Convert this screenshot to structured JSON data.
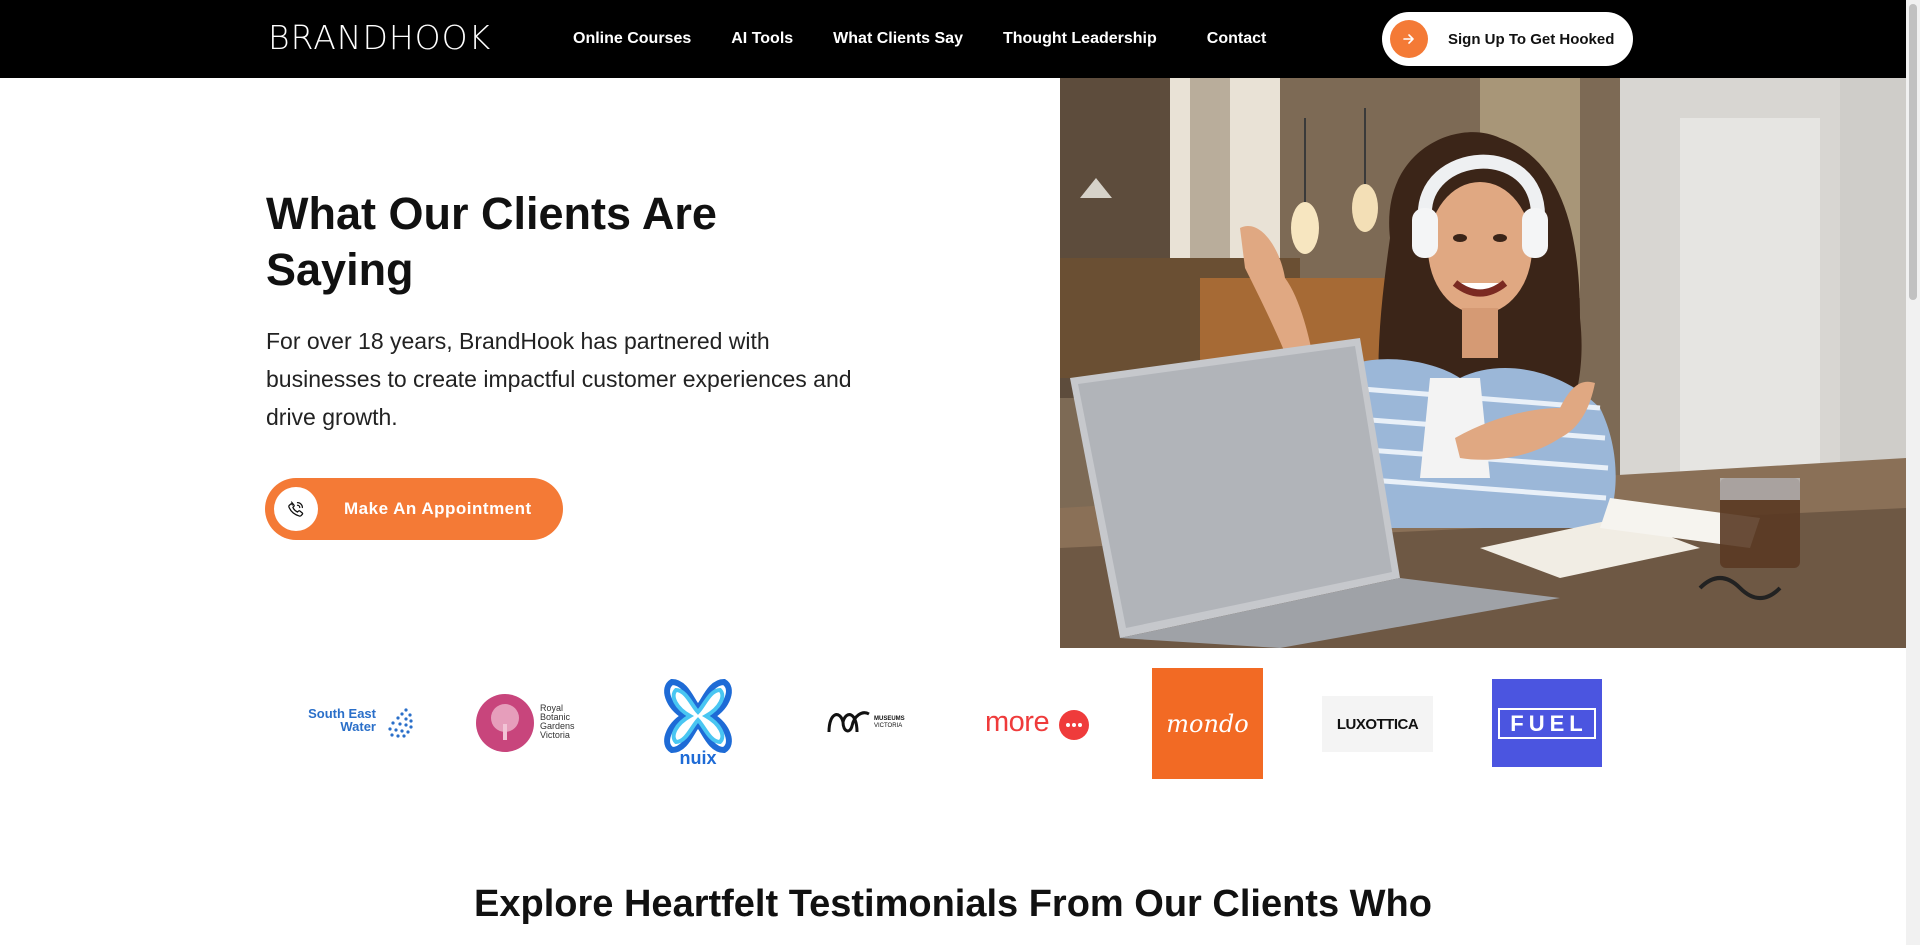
{
  "header": {
    "logo": "BRANDHOOK",
    "nav": [
      "Online Courses",
      "AI Tools",
      "What Clients Say",
      "Thought Leadership",
      "Contact"
    ],
    "cta_label": "Sign Up To Get Hooked",
    "cta_icon": "arrow-right-icon"
  },
  "hero": {
    "title": "What Our Clients Are Saying",
    "subtitle": "For over 18 years, BrandHook has partnered with businesses to create impactful customer experiences and drive growth.",
    "button_label": "Make An Appointment",
    "button_icon": "phone-icon",
    "image": "woman-with-headphones-on-video-call-photo"
  },
  "client_logos": {
    "south_east_water": [
      "South East",
      "Water"
    ],
    "royal_botanic": [
      "Royal",
      "Botanic",
      "Gardens",
      "Victoria"
    ],
    "nuix": "nuix",
    "museums": [
      "MUSEUMS",
      "VICTORIA"
    ],
    "more": "more",
    "mondo": "mondo",
    "luxottica": "LUXOTTICA",
    "fuel": "FUEL"
  },
  "explore": {
    "bold": "Explore Heartfelt Testimonials From Our Clients",
    "rest": " Who"
  },
  "colors": {
    "accent": "#f47a36",
    "header_bg": "#000000",
    "fuel_bg": "#4b55e0",
    "mondo_bg": "#f26a24",
    "more_red": "#ef3b3b",
    "botanic_pink": "#c8457c",
    "nuix_blue": "#1e6bd6",
    "sew_blue": "#2a6fc9"
  }
}
